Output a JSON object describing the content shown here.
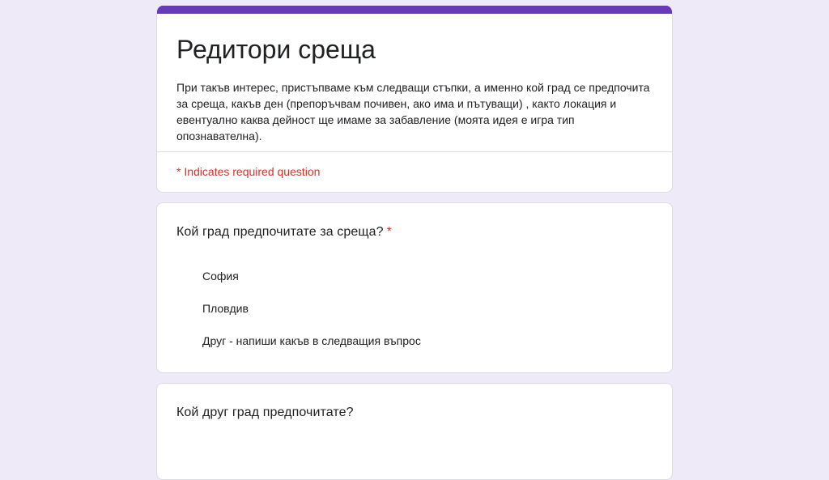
{
  "form": {
    "title": "Редитори среща",
    "description": "При такъв интерес, пристъпваме към следващи стъпки, а именно кой град се предпочита за среща, какъв ден (препоръчвам почивен, ако има и пътуващи) , както локация и евентуално каква дейност ще имаме за забавление (моята идея е игра тип опознавателна).",
    "required_note": "* Indicates required question",
    "accent_color": "#673ab7",
    "required_color": "#d93025"
  },
  "questions": [
    {
      "title": "Кой град предпочитате за среща?",
      "required_mark": "*",
      "options": [
        "София",
        "Пловдив",
        "Друг - напиши какъв в следващия въпрос"
      ]
    },
    {
      "title": "Кой друг град предпочитате?"
    }
  ]
}
